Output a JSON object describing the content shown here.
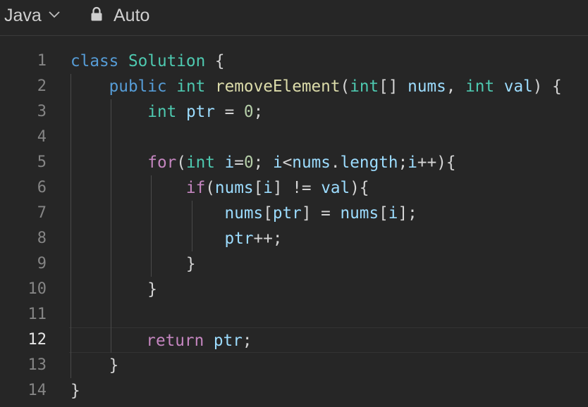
{
  "toolbar": {
    "language": "Java",
    "language_icon": "chevron-down-icon",
    "mode_icon": "lock-icon",
    "mode": "Auto"
  },
  "editor": {
    "active_line": 12,
    "line_numbers": [
      "1",
      "2",
      "3",
      "4",
      "5",
      "6",
      "7",
      "8",
      "9",
      "10",
      "11",
      "12",
      "13",
      "14"
    ],
    "lines": [
      [
        {
          "t": "class",
          "c": "kw-blue"
        },
        {
          "t": " ",
          "c": "plain"
        },
        {
          "t": "Solution",
          "c": "type"
        },
        {
          "t": " {",
          "c": "plain"
        }
      ],
      [
        {
          "t": "    ",
          "c": "plain"
        },
        {
          "t": "public",
          "c": "kw-blue"
        },
        {
          "t": " ",
          "c": "plain"
        },
        {
          "t": "int",
          "c": "type"
        },
        {
          "t": " ",
          "c": "plain"
        },
        {
          "t": "removeElement",
          "c": "fn"
        },
        {
          "t": "(",
          "c": "plain"
        },
        {
          "t": "int",
          "c": "type"
        },
        {
          "t": "[] ",
          "c": "plain"
        },
        {
          "t": "nums",
          "c": "var"
        },
        {
          "t": ", ",
          "c": "plain"
        },
        {
          "t": "int",
          "c": "type"
        },
        {
          "t": " ",
          "c": "plain"
        },
        {
          "t": "val",
          "c": "var"
        },
        {
          "t": ") {",
          "c": "plain"
        }
      ],
      [
        {
          "t": "        ",
          "c": "plain"
        },
        {
          "t": "int",
          "c": "type"
        },
        {
          "t": " ",
          "c": "plain"
        },
        {
          "t": "ptr",
          "c": "var"
        },
        {
          "t": " = ",
          "c": "plain"
        },
        {
          "t": "0",
          "c": "num"
        },
        {
          "t": ";",
          "c": "plain"
        }
      ],
      [],
      [
        {
          "t": "        ",
          "c": "plain"
        },
        {
          "t": "for",
          "c": "kw-purple"
        },
        {
          "t": "(",
          "c": "plain"
        },
        {
          "t": "int",
          "c": "type"
        },
        {
          "t": " ",
          "c": "plain"
        },
        {
          "t": "i",
          "c": "var"
        },
        {
          "t": "=",
          "c": "plain"
        },
        {
          "t": "0",
          "c": "num"
        },
        {
          "t": "; ",
          "c": "plain"
        },
        {
          "t": "i",
          "c": "var"
        },
        {
          "t": "<",
          "c": "plain"
        },
        {
          "t": "nums",
          "c": "var"
        },
        {
          "t": ".",
          "c": "plain"
        },
        {
          "t": "length",
          "c": "var"
        },
        {
          "t": ";",
          "c": "plain"
        },
        {
          "t": "i",
          "c": "var"
        },
        {
          "t": "++){",
          "c": "plain"
        }
      ],
      [
        {
          "t": "            ",
          "c": "plain"
        },
        {
          "t": "if",
          "c": "kw-purple"
        },
        {
          "t": "(",
          "c": "plain"
        },
        {
          "t": "nums",
          "c": "var"
        },
        {
          "t": "[",
          "c": "plain"
        },
        {
          "t": "i",
          "c": "var"
        },
        {
          "t": "] != ",
          "c": "plain"
        },
        {
          "t": "val",
          "c": "var"
        },
        {
          "t": "){",
          "c": "plain"
        }
      ],
      [
        {
          "t": "                ",
          "c": "plain"
        },
        {
          "t": "nums",
          "c": "var"
        },
        {
          "t": "[",
          "c": "plain"
        },
        {
          "t": "ptr",
          "c": "var"
        },
        {
          "t": "] = ",
          "c": "plain"
        },
        {
          "t": "nums",
          "c": "var"
        },
        {
          "t": "[",
          "c": "plain"
        },
        {
          "t": "i",
          "c": "var"
        },
        {
          "t": "];",
          "c": "plain"
        }
      ],
      [
        {
          "t": "                ",
          "c": "plain"
        },
        {
          "t": "ptr",
          "c": "var"
        },
        {
          "t": "++;",
          "c": "plain"
        }
      ],
      [
        {
          "t": "            }",
          "c": "plain"
        }
      ],
      [
        {
          "t": "        }",
          "c": "plain"
        }
      ],
      [],
      [
        {
          "t": "        ",
          "c": "plain"
        },
        {
          "t": "return",
          "c": "kw-purple"
        },
        {
          "t": " ",
          "c": "plain"
        },
        {
          "t": "ptr",
          "c": "var"
        },
        {
          "t": ";",
          "c": "plain"
        }
      ],
      [
        {
          "t": "    }",
          "c": "plain"
        }
      ],
      [
        {
          "t": "}",
          "c": "plain"
        }
      ]
    ]
  },
  "colors": {
    "background": "#262626",
    "keyword_blue": "#569cd6",
    "keyword_purple": "#c586c0",
    "type": "#4ec9b0",
    "function": "#dcdcaa",
    "variable": "#9cdcfe",
    "number": "#b5cea8",
    "text": "#d4d4d4",
    "line_number": "#858585"
  }
}
